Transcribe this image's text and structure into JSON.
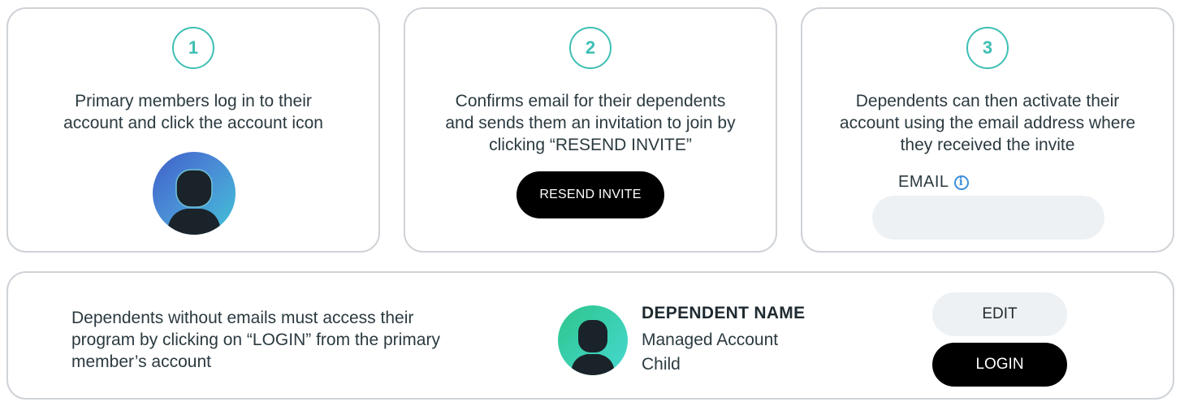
{
  "steps": [
    {
      "number": "1",
      "text": "Primary members log in to their\naccount and click the account icon"
    },
    {
      "number": "2",
      "text": "Confirms email for their dependents\nand sends them an invitation to join by\nclicking “RESEND INVITE”",
      "button_label": "RESEND INVITE"
    },
    {
      "number": "3",
      "text": "Dependents can then activate their\naccount using the email address where\nthey received the invite",
      "email_label": "EMAIL",
      "email_value": ""
    }
  ],
  "dependents": {
    "text": "Dependents without emails must access their\nprogram by clicking on “LOGIN” from the primary\nmember’s account",
    "name": "DEPENDENT NAME",
    "account_type": "Managed Account",
    "relation": "Child",
    "edit_label": "EDIT",
    "login_label": "LOGIN"
  },
  "icons": {
    "account": "user-avatar-icon",
    "info": "info-icon"
  },
  "colors": {
    "accent": "#3ebfb4",
    "info": "#3b8fd9",
    "button_dark": "#000000",
    "button_light": "#eef1f4"
  }
}
